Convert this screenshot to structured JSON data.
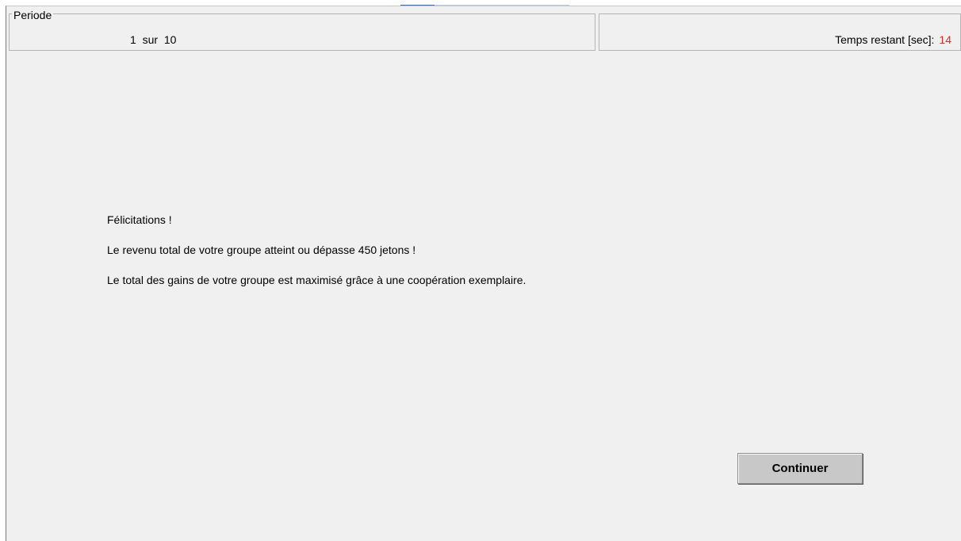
{
  "header": {
    "period": {
      "legend": "Periode",
      "current": "1",
      "separator": "sur",
      "total": "10"
    },
    "timer": {
      "label": "Temps restant [sec]:",
      "value": "14",
      "value_color": "#e0281e"
    }
  },
  "message": {
    "lines": [
      "Félicitations !",
      "Le revenu total de votre groupe atteint ou dépasse 450 jetons !",
      "Le total des gains de votre groupe est maximisé grâce à une coopération exemplaire."
    ]
  },
  "actions": {
    "continue_label": "Continuer"
  },
  "colors": {
    "background": "#f0f0f0",
    "button": "#c8c8c8",
    "timer_value": "#e0281e",
    "top_accent": "#2f6fd0"
  }
}
